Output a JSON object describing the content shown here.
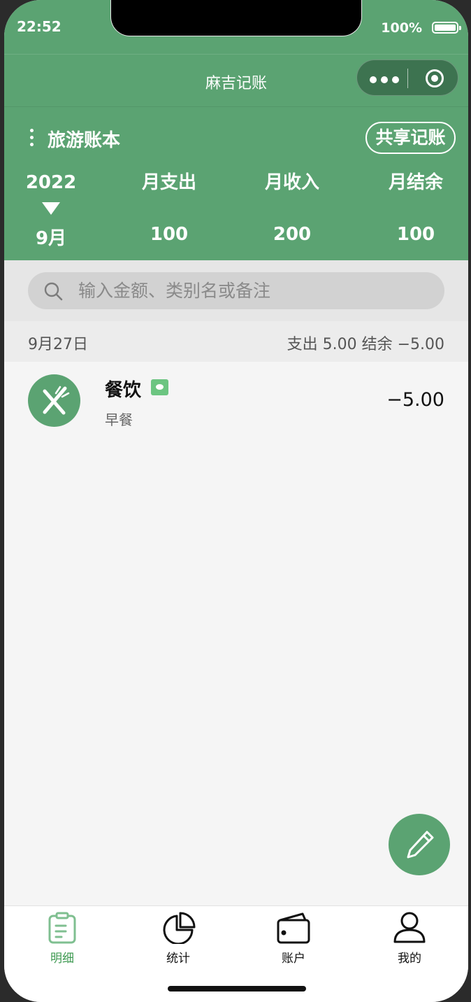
{
  "status_bar": {
    "time": "22:52",
    "battery": "100%"
  },
  "navbar": {
    "title": "麻吉记账",
    "more_icon": "more-dots-icon",
    "close_icon": "target-circle-icon"
  },
  "book": {
    "name": "旅游账本",
    "share_label": "共享记账"
  },
  "summary": {
    "year": "2022",
    "month": "9月",
    "expense_label": "月支出",
    "expense_value": "100",
    "income_label": "月收入",
    "income_value": "200",
    "balance_label": "月结余",
    "balance_value": "100"
  },
  "search": {
    "placeholder": "输入金额、类别名或备注"
  },
  "day_groups": [
    {
      "date": "9月27日",
      "summary": "支出 5.00  结余 −5.00",
      "entries": [
        {
          "icon": "fork-knife-icon",
          "category": "餐饮",
          "note": "早餐",
          "amount": "−5.00"
        }
      ]
    }
  ],
  "tabs": [
    {
      "label": "明细",
      "icon": "clipboard-icon",
      "active": true
    },
    {
      "label": "统计",
      "icon": "pie-chart-icon",
      "active": false
    },
    {
      "label": "账户",
      "icon": "wallet-icon",
      "active": false
    },
    {
      "label": "我的",
      "icon": "person-icon",
      "active": false
    }
  ],
  "colors": {
    "primary": "#5ba372",
    "active_tab": "#3f9a52"
  }
}
